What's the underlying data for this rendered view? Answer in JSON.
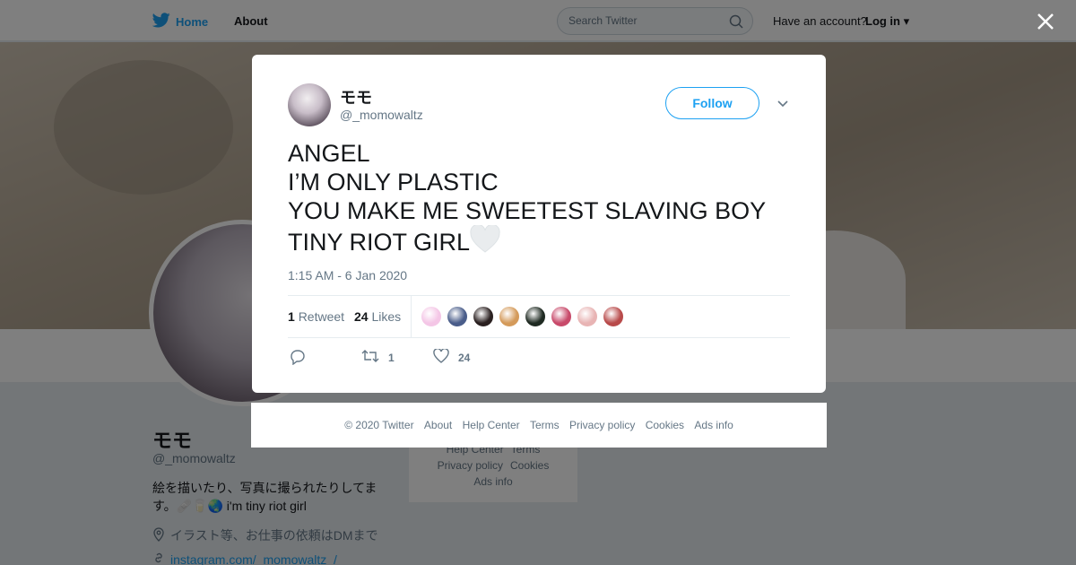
{
  "topbar": {
    "home_label": "Home",
    "about_label": "About",
    "search_placeholder": "Search Twitter",
    "have_account": "Have an account?",
    "login_label": "Log in"
  },
  "profile": {
    "name": "モモ",
    "handle": "@_momowaltz",
    "bio_line1": "絵を描いたり、写真に撮られたりしてま",
    "bio_line2": "す。🩹🥛🌏 i'm tiny riot girl",
    "location": "イラスト等、お仕事の依頼はDMまで",
    "link": "instagram.com/_momowaltz_/"
  },
  "bg_footer": {
    "row1": [
      "Help Center",
      "Terms"
    ],
    "row2": [
      "Privacy policy",
      "Cookies"
    ],
    "row3": [
      "Ads info"
    ]
  },
  "tweet": {
    "author_name": "モモ",
    "author_handle": "@_momowaltz",
    "follow_label": "Follow",
    "lines": [
      "ANGEL",
      "I’M ONLY PLASTIC",
      "YOU MAKE ME SWEETEST SLAVING BOY",
      "TINY RIOT GIRL"
    ],
    "timestamp": "1:15 AM - 6 Jan 2020",
    "retweet_count": "1",
    "retweet_label": "Retweet",
    "like_count": "24",
    "like_label": "Likes",
    "actions": {
      "retweets": "1",
      "likes": "24"
    },
    "liker_colors": [
      "#f4c6e6",
      "#4a5d8a",
      "#2a2020",
      "#d49a5a",
      "#1f2a22",
      "#c84a6a",
      "#e8b4b4",
      "#b84a4a"
    ]
  },
  "footer": {
    "copyright": "© 2020 Twitter",
    "links": [
      "About",
      "Help Center",
      "Terms",
      "Privacy policy",
      "Cookies",
      "Ads info"
    ]
  },
  "colors": {
    "accent": "#1da1f2",
    "overlay": "rgba(0,0,0,0.5)"
  }
}
